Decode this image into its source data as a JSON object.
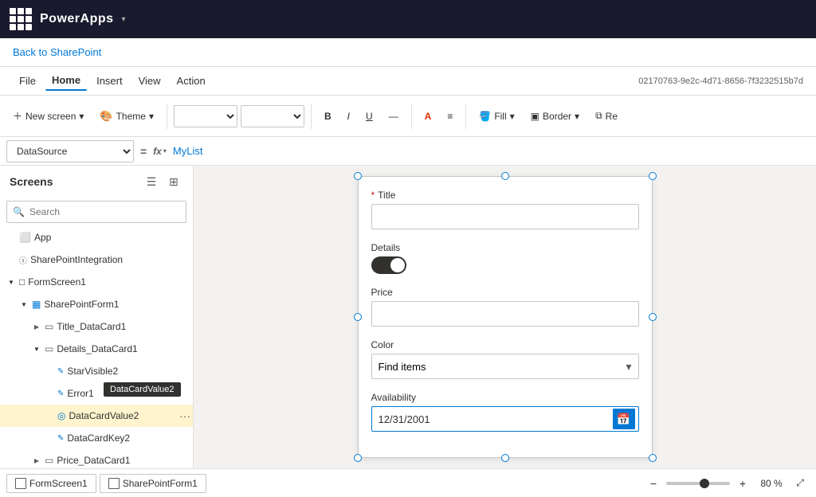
{
  "topbar": {
    "app_name": "PowerApps",
    "chevron": "▾"
  },
  "back_bar": {
    "back_link": "Back to SharePoint"
  },
  "menu": {
    "items": [
      "File",
      "Home",
      "Insert",
      "View",
      "Action"
    ],
    "active": "Home",
    "account_id": "02170763-9e2c-4d71-8656-7f3232515b7d"
  },
  "ribbon": {
    "new_screen_label": "New screen",
    "theme_label": "Theme",
    "bold_symbol": "B",
    "italic_symbol": "I",
    "underline_symbol": "U",
    "strikethrough_symbol": "—",
    "font_color_symbol": "A",
    "align_symbol": "≡",
    "fill_label": "Fill",
    "border_label": "Border",
    "reorder_label": "Re"
  },
  "formula_bar": {
    "datasource_value": "DataSource",
    "equals": "=",
    "fx": "fx",
    "formula_value": "MyList"
  },
  "left_panel": {
    "title": "Screens",
    "search_placeholder": "Search",
    "tree_items": [
      {
        "id": "app",
        "label": "App",
        "level": 0,
        "icon": "⬜",
        "expand": false,
        "type": "app"
      },
      {
        "id": "spi",
        "label": "SharePointIntegration",
        "level": 0,
        "icon": "⓪",
        "expand": false,
        "type": "integration"
      },
      {
        "id": "formscreen1",
        "label": "FormScreen1",
        "level": 0,
        "icon": "□",
        "expand": true,
        "type": "screen"
      },
      {
        "id": "sharepointform1",
        "label": "SharePointForm1",
        "level": 1,
        "icon": "▦",
        "expand": true,
        "type": "form"
      },
      {
        "id": "title_datacard1",
        "label": "Title_DataCard1",
        "level": 2,
        "icon": "▭",
        "expand": false,
        "type": "card"
      },
      {
        "id": "details_datacard1",
        "label": "Details_DataCard1",
        "level": 2,
        "icon": "▭",
        "expand": true,
        "type": "card"
      },
      {
        "id": "starvisible2",
        "label": "StarVisible2",
        "level": 3,
        "icon": "✎",
        "expand": false,
        "type": "control"
      },
      {
        "id": "errormessage",
        "label": "Error1",
        "level": 3,
        "icon": "✎",
        "expand": false,
        "type": "control"
      },
      {
        "id": "datacardvalue2",
        "label": "DataCardValue2",
        "level": 3,
        "icon": "◎",
        "expand": false,
        "type": "control",
        "selected": true
      },
      {
        "id": "datacardkey2",
        "label": "DataCardKey2",
        "level": 3,
        "icon": "✎",
        "expand": false,
        "type": "control"
      },
      {
        "id": "price_datacard1",
        "label": "Price_DataCard1",
        "level": 2,
        "icon": "▭",
        "expand": false,
        "type": "card"
      }
    ]
  },
  "form": {
    "fields": [
      {
        "id": "title",
        "label": "Title",
        "required": true,
        "type": "text",
        "value": ""
      },
      {
        "id": "details",
        "label": "Details",
        "required": false,
        "type": "toggle",
        "value": true
      },
      {
        "id": "price",
        "label": "Price",
        "required": false,
        "type": "text",
        "value": ""
      },
      {
        "id": "color",
        "label": "Color",
        "required": false,
        "type": "dropdown",
        "value": "Find items"
      },
      {
        "id": "availability",
        "label": "Availability",
        "required": false,
        "type": "date",
        "value": "12/31/2001"
      }
    ]
  },
  "bottom_bar": {
    "tabs": [
      {
        "id": "formscreen1",
        "label": "FormScreen1"
      },
      {
        "id": "sharepointform1",
        "label": "SharePointForm1"
      }
    ],
    "zoom_level": "80 %",
    "zoom_minus": "−",
    "zoom_plus": "+"
  },
  "tooltip": {
    "text": "DataCardValue2"
  }
}
